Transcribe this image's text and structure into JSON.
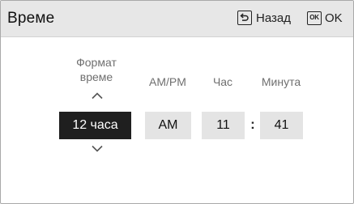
{
  "header": {
    "title": "Време",
    "back_label": "Назад",
    "ok_icon_text": "OK",
    "ok_label": "OK",
    "back_icon": "return-arrow-icon",
    "ok_icon": "ok-box-icon"
  },
  "labels": {
    "format": "Формат\nвреме",
    "ampm": "AM/PM",
    "hour": "Час",
    "minute": "Минута"
  },
  "values": {
    "format": "12 часа",
    "ampm": "AM",
    "hour": "11",
    "separator": ":",
    "minute": "41"
  },
  "icons": {
    "up": "chevron-up-icon",
    "down": "chevron-down-icon"
  },
  "colors": {
    "header_bg": "#e7e7e7",
    "selected_bg": "#1f1f1f",
    "selected_text": "#ffffff",
    "field_bg": "#e4e4e4",
    "label_text": "#6f6f6f"
  }
}
